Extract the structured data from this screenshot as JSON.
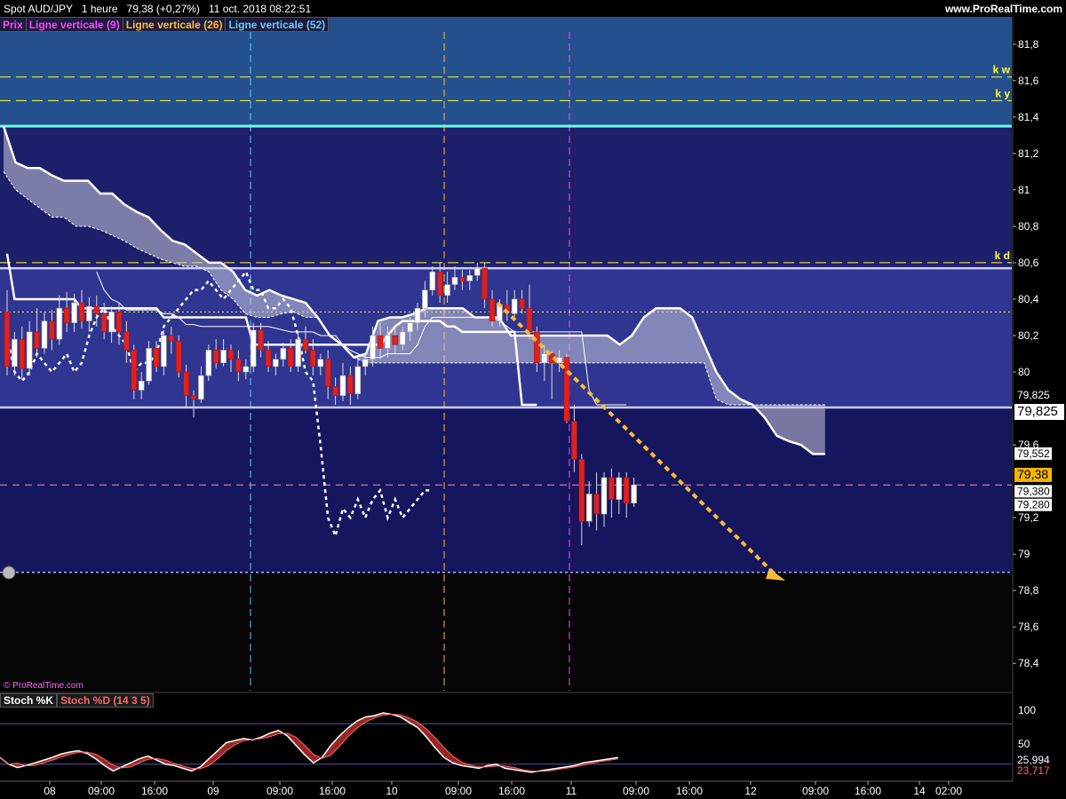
{
  "header": {
    "title": "Spot AUD/JPY   1 heure   79,38 (+0,27%)   11 oct. 2018 08:22:51",
    "site": "www.ProRealTime.com"
  },
  "legend": [
    {
      "label": "Prix",
      "color": "#ff44ff"
    },
    {
      "label": "Ligne verticale (9)",
      "color": "#ff44ff"
    },
    {
      "label": "Ligne verticale (26)",
      "color": "#ffbb33"
    },
    {
      "label": "Ligne verticale (52)",
      "color": "#66ccff"
    }
  ],
  "credit": "© ProRealTime.com",
  "stoch_legend": {
    "k": "Stoch %K",
    "d": "Stoch %D (14 3 5)"
  },
  "price_axis": {
    "ticks": [
      "81,8",
      "81,6",
      "81,4",
      "81,2",
      "81",
      "80,8",
      "80,6",
      "80,4",
      "80,2",
      "80",
      "79,6",
      "79,2",
      "79",
      "78,8",
      "78,6",
      "78,4"
    ],
    "tag_79825_small": "79,825",
    "tag_79825_big": "79,825",
    "tag_79552": "79,552",
    "tag_price": "79,38",
    "tag_79380": "79,380",
    "tag_79280": "79,280"
  },
  "level_labels": {
    "kw": "k w",
    "ky": "k y",
    "kd": "k d"
  },
  "stoch_axis": {
    "t100": "100",
    "t50": "50",
    "k_value": "25,994",
    "d_value": "23,717"
  },
  "time_axis": [
    "08",
    "09:00",
    "16:00",
    "09",
    "09:00",
    "16:00",
    "10",
    "09:00",
    "16:00",
    "11",
    "09:00",
    "16:00",
    "12",
    "09:00",
    "16:00",
    "14",
    "02:00"
  ],
  "colors": {
    "up": "#ffffff",
    "down": "#dd2222",
    "kijun": "#ffffff",
    "tenkan": "#ffffff",
    "cloud": "#c8c8d8",
    "arrow": "#ffbb33",
    "level": "#ffff33",
    "cyan_line": "#66ffdd",
    "box_line": "#ccccff"
  },
  "chart_data": {
    "type": "candlestick",
    "symbol": "Spot AUD/JPY",
    "timeframe": "1 heure",
    "ylim": [
      78.25,
      81.95
    ],
    "levels": [
      {
        "name": "k w",
        "value": 81.62
      },
      {
        "name": "k y",
        "value": 81.49
      },
      {
        "name": "k d",
        "value": 80.6
      },
      {
        "name": "cyan",
        "value": 81.35
      },
      {
        "name": "box_top",
        "value": 80.57
      },
      {
        "name": "box_bottom",
        "value": 79.805
      },
      {
        "name": "price",
        "value": 79.38
      },
      {
        "name": "yellow_dotted",
        "value": 80.33
      },
      {
        "name": "blue_dotted",
        "value": 78.9
      }
    ],
    "candles": [
      [
        80.33,
        80.03,
        80.45,
        79.98
      ],
      [
        80.03,
        80.18,
        80.22,
        79.98
      ],
      [
        80.18,
        80.02,
        80.25,
        79.96
      ],
      [
        80.02,
        80.22,
        80.28,
        79.98
      ],
      [
        80.22,
        80.13,
        80.35,
        80.08
      ],
      [
        80.13,
        80.28,
        80.33,
        80.1
      ],
      [
        80.28,
        80.18,
        80.34,
        80.12
      ],
      [
        80.18,
        80.35,
        80.42,
        80.15
      ],
      [
        80.35,
        80.27,
        80.44,
        80.22
      ],
      [
        80.27,
        80.38,
        80.43,
        80.22
      ],
      [
        80.38,
        80.28,
        80.45,
        80.24
      ],
      [
        80.28,
        80.36,
        80.41,
        80.22
      ],
      [
        80.36,
        80.32,
        80.42,
        80.25
      ],
      [
        80.32,
        80.22,
        80.38,
        80.18
      ],
      [
        80.22,
        80.33,
        80.36,
        80.16
      ],
      [
        80.33,
        80.22,
        80.38,
        80.15
      ],
      [
        80.22,
        80.12,
        80.28,
        80.05
      ],
      [
        80.12,
        79.9,
        80.15,
        79.85
      ],
      [
        79.9,
        79.95,
        80.0,
        79.85
      ],
      [
        79.95,
        80.13,
        80.17,
        79.93
      ],
      [
        80.13,
        80.03,
        80.17,
        80.0
      ],
      [
        80.03,
        80.2,
        80.23,
        79.98
      ],
      [
        80.2,
        80.17,
        80.25,
        80.1
      ],
      [
        80.17,
        80.0,
        80.2,
        79.97
      ],
      [
        80.0,
        79.87,
        80.04,
        79.8
      ],
      [
        79.87,
        79.85,
        79.9,
        79.75
      ],
      [
        79.85,
        79.98,
        80.03,
        79.83
      ],
      [
        79.98,
        80.12,
        80.15,
        79.95
      ],
      [
        80.12,
        80.05,
        80.18,
        80.02
      ],
      [
        80.05,
        80.12,
        80.18,
        80.03
      ],
      [
        80.12,
        80.07,
        80.15,
        80.0
      ],
      [
        80.07,
        80.0,
        80.12,
        79.95
      ],
      [
        80.0,
        80.03,
        80.07,
        79.96
      ],
      [
        80.03,
        80.23,
        80.27,
        80.0
      ],
      [
        80.23,
        80.12,
        80.27,
        80.08
      ],
      [
        80.12,
        80.03,
        80.17,
        80.0
      ],
      [
        80.03,
        80.07,
        80.1,
        79.98
      ],
      [
        80.07,
        80.13,
        80.16,
        80.03
      ],
      [
        80.13,
        80.03,
        80.18,
        80.0
      ],
      [
        80.03,
        80.18,
        80.22,
        80.0
      ],
      [
        80.18,
        80.12,
        80.25,
        80.1
      ],
      [
        80.12,
        80.03,
        80.18,
        79.98
      ],
      [
        80.03,
        80.07,
        80.1,
        79.98
      ],
      [
        80.07,
        79.92,
        80.12,
        79.85
      ],
      [
        79.92,
        79.87,
        79.97,
        79.82
      ],
      [
        79.87,
        79.98,
        80.05,
        79.84
      ],
      [
        79.98,
        79.88,
        80.03,
        79.82
      ],
      [
        79.88,
        80.03,
        80.08,
        79.85
      ],
      [
        80.03,
        80.07,
        80.1,
        79.98
      ],
      [
        80.07,
        80.2,
        80.25,
        80.03
      ],
      [
        80.2,
        80.13,
        80.27,
        80.07
      ],
      [
        80.13,
        80.2,
        80.25,
        80.08
      ],
      [
        80.2,
        80.15,
        80.25,
        80.1
      ],
      [
        80.15,
        80.22,
        80.25,
        80.12
      ],
      [
        80.22,
        80.27,
        80.3,
        80.17
      ],
      [
        80.27,
        80.35,
        80.38,
        80.23
      ],
      [
        80.35,
        80.45,
        80.5,
        80.3
      ],
      [
        80.45,
        80.55,
        80.58,
        80.42
      ],
      [
        80.55,
        80.42,
        80.6,
        80.38
      ],
      [
        80.42,
        80.48,
        80.55,
        80.38
      ],
      [
        80.48,
        80.52,
        80.58,
        80.45
      ],
      [
        80.52,
        80.5,
        80.56,
        80.45
      ],
      [
        80.5,
        80.53,
        80.56,
        80.45
      ],
      [
        80.53,
        80.57,
        80.6,
        80.5
      ],
      [
        80.57,
        80.4,
        80.6,
        80.35
      ],
      [
        80.4,
        80.28,
        80.45,
        80.25
      ],
      [
        80.28,
        80.37,
        80.4,
        80.25
      ],
      [
        80.37,
        80.32,
        80.45,
        80.28
      ],
      [
        80.32,
        80.4,
        80.45,
        80.3
      ],
      [
        80.4,
        80.35,
        80.45,
        80.32
      ],
      [
        80.35,
        80.22,
        80.48,
        80.18
      ],
      [
        80.22,
        80.05,
        80.25,
        80.0
      ],
      [
        80.05,
        80.1,
        80.15,
        79.95
      ],
      [
        80.1,
        80.05,
        80.12,
        79.85
      ],
      [
        80.05,
        80.08,
        80.12,
        80.0
      ],
      [
        80.08,
        79.73,
        80.1,
        79.72
      ],
      [
        79.73,
        79.52,
        79.82,
        79.45
      ],
      [
        79.52,
        79.18,
        79.55,
        79.05
      ],
      [
        79.18,
        79.33,
        79.4,
        79.15
      ],
      [
        79.33,
        79.22,
        79.45,
        79.13
      ],
      [
        79.22,
        79.42,
        79.45,
        79.15
      ],
      [
        79.42,
        79.3,
        79.47,
        79.2
      ],
      [
        79.3,
        79.42,
        79.45,
        79.22
      ],
      [
        79.42,
        79.28,
        79.45,
        79.2
      ],
      [
        79.28,
        79.38,
        79.42,
        79.26
      ]
    ],
    "tenkan": [
      80.55,
      80.45,
      80.4,
      80.38,
      80.34,
      80.34,
      80.34,
      80.34,
      80.34,
      80.32,
      80.32,
      80.3,
      80.26,
      80.26,
      80.25,
      80.25,
      80.25,
      80.25,
      80.25,
      80.25,
      80.25,
      80.25,
      80.25,
      80.25,
      80.24,
      80.23,
      80.22,
      80.22,
      80.22,
      80.22,
      80.2,
      80.2,
      80.2,
      80.15,
      80.12,
      80.1,
      80.08,
      80.08,
      80.08,
      80.1,
      80.1,
      80.1,
      80.1,
      80.15,
      80.25,
      80.3,
      80.3,
      80.3,
      80.3,
      80.3,
      80.3,
      80.3,
      80.3,
      80.3,
      80.28,
      80.25,
      80.22,
      80.22,
      80.22,
      80.22,
      80.22,
      80.22,
      80.22,
      80.22,
      80.22,
      80.22,
      79.9,
      79.82,
      79.82,
      79.82,
      79.82,
      79.82
    ],
    "kijun": [
      80.65,
      80.4,
      80.4,
      80.4,
      80.4,
      80.4,
      80.4,
      80.4,
      80.4,
      80.4,
      80.35,
      80.35,
      80.35,
      80.35,
      80.35,
      80.35,
      80.35,
      80.35,
      80.35,
      80.35,
      80.35,
      80.3,
      80.3,
      80.3,
      80.3,
      80.3,
      80.3,
      80.3,
      80.3,
      80.3,
      80.3,
      80.3,
      80.3,
      80.15,
      80.15,
      80.15,
      80.15,
      80.15,
      80.15,
      80.15,
      80.15,
      80.15,
      80.15,
      80.15,
      80.15,
      80.15,
      80.15,
      80.15,
      80.15,
      80.15,
      80.15,
      80.2,
      80.25,
      80.28,
      80.28,
      80.28,
      80.28,
      80.28,
      80.28,
      80.25,
      80.25,
      80.22,
      80.22,
      80.22,
      80.22,
      80.22,
      80.22,
      80.22,
      80.22,
      79.82,
      79.82,
      79.82
    ],
    "chikou": [
      80.2,
      80.0,
      79.95,
      80.0,
      80.1,
      80.05,
      80.0,
      80.05,
      80.1,
      80.0,
      80.05,
      80.2,
      80.3,
      80.35,
      80.25,
      80.2,
      80.15,
      80.0,
      80.05,
      80.05,
      80.1,
      80.25,
      80.3,
      80.35,
      80.4,
      80.45,
      80.45,
      80.5,
      80.45,
      80.4,
      80.45,
      80.5,
      80.55,
      80.45,
      80.45,
      80.35,
      80.35,
      80.4,
      80.35,
      80.2,
      80.0,
      79.95,
      79.6,
      79.2,
      79.1,
      79.25,
      79.2,
      79.3,
      79.2,
      79.3,
      79.35,
      79.2,
      79.3,
      79.2,
      79.25,
      79.3,
      79.35,
      79.35
    ]
  }
}
